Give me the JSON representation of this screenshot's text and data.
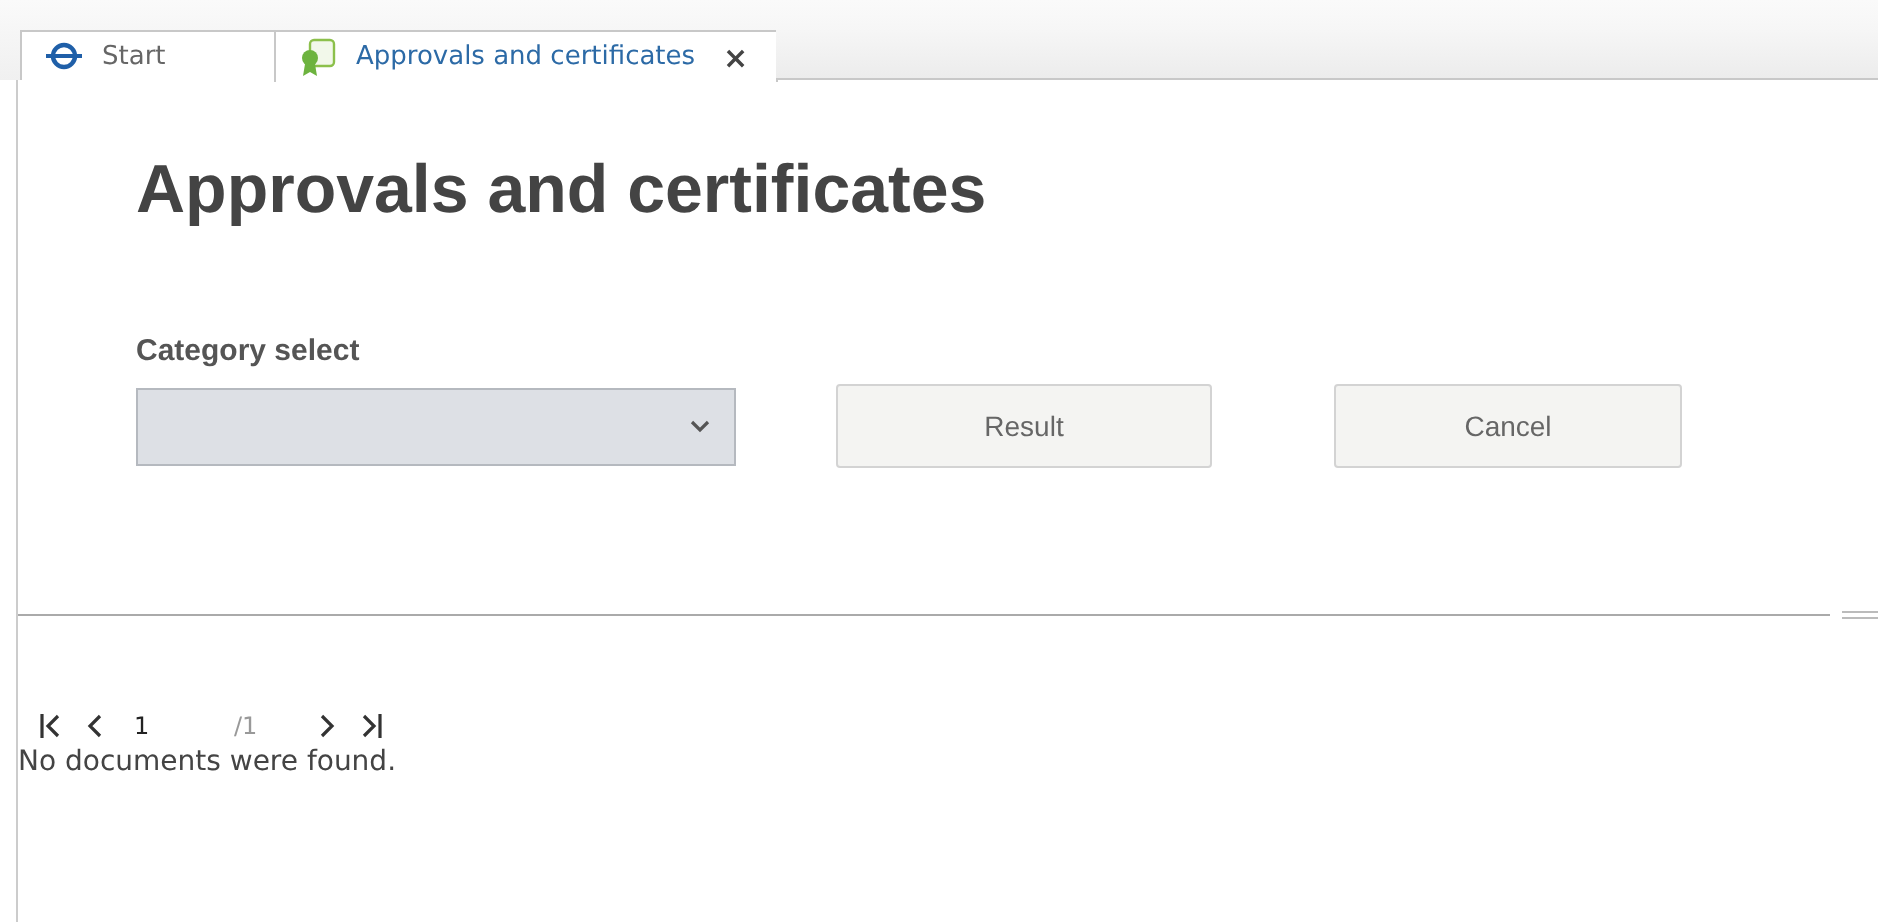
{
  "tabs": [
    {
      "label": "Start",
      "kind": "start",
      "selected": false
    },
    {
      "label": "Approvals and certificates",
      "kind": "document",
      "selected": true,
      "close": "×"
    }
  ],
  "page_title": "Approvals and certificates",
  "form": {
    "category_label": "Category select",
    "buttons": [
      "Result",
      "Cancel"
    ]
  },
  "pager": {
    "page": "1",
    "total": "/1"
  },
  "message": "No documents were found."
}
